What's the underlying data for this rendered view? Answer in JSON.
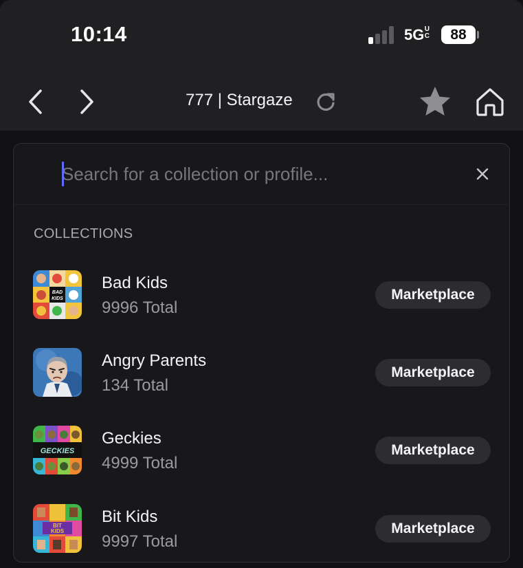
{
  "status_bar": {
    "time": "10:14",
    "network": "5G",
    "network_sub": "UC",
    "battery": "88"
  },
  "nav": {
    "title": "777 | Stargaze",
    "icons": [
      "back-arrow-icon",
      "forward-arrow-icon",
      "reload-icon",
      "star-icon",
      "home-icon"
    ]
  },
  "search": {
    "placeholder": "Search for a collection or profile...",
    "value": ""
  },
  "collections": {
    "heading": "COLLECTIONS",
    "items": [
      {
        "name": "Bad Kids",
        "total": "9996 Total",
        "action": "Marketplace",
        "thumb_colors": [
          "#ef7d2c",
          "#d8d8d8",
          "#f2c53d",
          "#3f8ad6",
          "#111111",
          "#e8e8e8",
          "#e24b3a",
          "#4fa3d8",
          "#f2c53d"
        ],
        "thumb_text": "BAD KIDS"
      },
      {
        "name": "Angry Parents",
        "total": "134 Total",
        "action": "Marketplace",
        "thumb_colors": [
          "#3c77b8",
          "#1f4c86",
          "#e3c7b2"
        ]
      },
      {
        "name": "Geckies",
        "total": "4999 Total",
        "action": "Marketplace",
        "thumb_colors": [
          "#3fb54a",
          "#7a52c7",
          "#e04aa1",
          "#f0c23a",
          "#111111",
          "#36b7d6",
          "#e24b3a",
          "#8acb49",
          "#f08a2c"
        ],
        "thumb_text": "GECKIES"
      },
      {
        "name": "Bit Kids",
        "total": "9997 Total",
        "action": "Marketplace",
        "thumb_colors": [
          "#e24b3a",
          "#f0c23a",
          "#3fb54a",
          "#3f8ad6",
          "#f08a2c",
          "#e04aa1",
          "#36b7d6",
          "#e24b3a",
          "#f0c23a"
        ],
        "thumb_text": "BIT KIDS"
      }
    ]
  }
}
